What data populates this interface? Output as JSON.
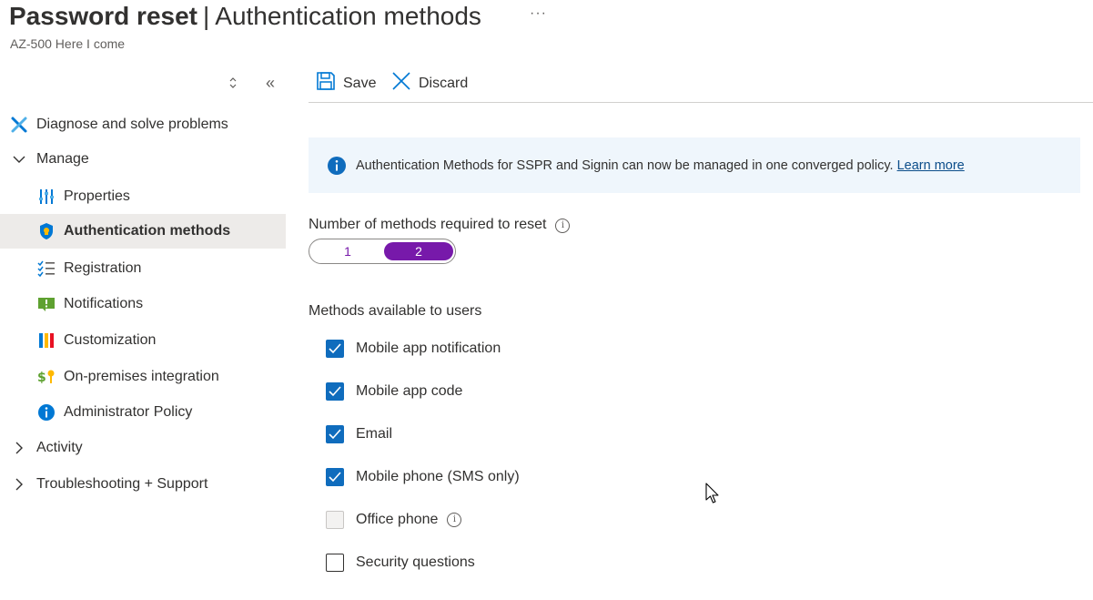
{
  "header": {
    "title_bold": "Password reset",
    "separator": "|",
    "title_light": "Authentication methods",
    "more": "···",
    "subtitle": "AZ-500 Here I come"
  },
  "sidebar": {
    "collapse_symbol": "«",
    "items": [
      {
        "label": "Diagnose and solve problems",
        "icon": "wrench-icon"
      },
      {
        "label": "Manage",
        "icon": "chevron-down-icon"
      },
      {
        "label": "Properties",
        "icon": "properties-icon"
      },
      {
        "label": "Authentication methods",
        "icon": "shield-icon",
        "selected": true
      },
      {
        "label": "Registration",
        "icon": "checklist-icon"
      },
      {
        "label": "Notifications",
        "icon": "notification-icon"
      },
      {
        "label": "Customization",
        "icon": "customization-icon"
      },
      {
        "label": "On-premises integration",
        "icon": "key-sync-icon"
      },
      {
        "label": "Administrator Policy",
        "icon": "info-icon"
      },
      {
        "label": "Activity",
        "icon": "chevron-right-icon"
      },
      {
        "label": "Troubleshooting + Support",
        "icon": "chevron-right-icon"
      }
    ]
  },
  "toolbar": {
    "save_label": "Save",
    "discard_label": "Discard"
  },
  "banner": {
    "text": "Authentication Methods for SSPR and Signin can now be managed in one converged policy.",
    "link": "Learn more"
  },
  "methods_required": {
    "label": "Number of methods required to reset",
    "info": "i",
    "options": [
      "1",
      "2"
    ],
    "selected": "2"
  },
  "methods_available": {
    "label": "Methods available to users",
    "items": [
      {
        "label": "Mobile app notification",
        "checked": true
      },
      {
        "label": "Mobile app code",
        "checked": true
      },
      {
        "label": "Email",
        "checked": true
      },
      {
        "label": "Mobile phone (SMS only)",
        "checked": true
      },
      {
        "label": "Office phone",
        "checked": false,
        "disabled": true,
        "info": "i"
      },
      {
        "label": "Security questions",
        "checked": false
      }
    ]
  },
  "colors": {
    "accent_purple": "#7719aa",
    "checkbox_blue": "#0f6cbd",
    "banner_bg": "#eff6fc",
    "selected_nav_bg": "#edebe9"
  }
}
